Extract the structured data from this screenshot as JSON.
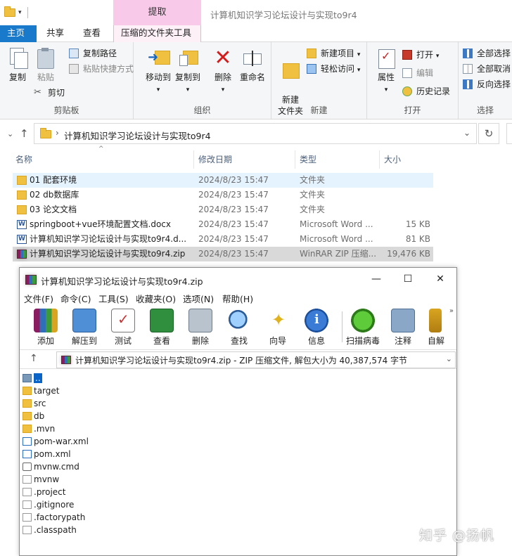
{
  "window": {
    "title": "计算机知识学习论坛设计与实现to9r4",
    "context_tab_header": "提取"
  },
  "tabs": [
    "主页",
    "共享",
    "查看",
    "压缩的文件夹工具"
  ],
  "ribbon": {
    "clipboard": {
      "label": "剪贴板",
      "copy": "复制",
      "paste": "粘贴",
      "copy_path": "复制路径",
      "paste_shortcut": "粘贴快捷方式",
      "cut": "剪切"
    },
    "organize": {
      "label": "组织",
      "move_to": "移动到",
      "copy_to": "复制到",
      "delete": "删除",
      "rename": "重命名"
    },
    "new": {
      "label": "新建",
      "new_folder": "新建\n文件夹",
      "new_item": "新建项目",
      "easy_access": "轻松访问"
    },
    "open": {
      "label": "打开",
      "properties": "属性",
      "open": "打开",
      "edit": "编辑",
      "history": "历史记录"
    },
    "select": {
      "label": "选择",
      "select_all": "全部选择",
      "select_none": "全部取消",
      "invert": "反向选择"
    }
  },
  "address": {
    "path": "计算机知识学习论坛设计与实现to9r4"
  },
  "columns": {
    "name": "名称",
    "date": "修改日期",
    "type": "类型",
    "size": "大小"
  },
  "files": [
    {
      "name": "01 配套环境",
      "date": "2024/8/23 15:47",
      "type": "文件夹",
      "size": "",
      "icon": "folder"
    },
    {
      "name": "02 db数据库",
      "date": "2024/8/23 15:47",
      "type": "文件夹",
      "size": "",
      "icon": "folder"
    },
    {
      "name": "03 论文文档",
      "date": "2024/8/23 15:47",
      "type": "文件夹",
      "size": "",
      "icon": "folder"
    },
    {
      "name": "springboot+vue环境配置文档.docx",
      "date": "2024/8/23 15:47",
      "type": "Microsoft Word ...",
      "size": "15 KB",
      "icon": "word"
    },
    {
      "name": "计算机知识学习论坛设计与实现to9r4.d...",
      "date": "2024/8/23 15:47",
      "type": "Microsoft Word ...",
      "size": "81 KB",
      "icon": "word"
    },
    {
      "name": "计算机知识学习论坛设计与实现to9r4.zip",
      "date": "2024/8/23 15:47",
      "type": "WinRAR ZIP 压缩...",
      "size": "19,476 KB",
      "icon": "rar"
    }
  ],
  "winrar": {
    "title": "计算机知识学习论坛设计与实现to9r4.zip",
    "menu": [
      "文件(F)",
      "命令(C)",
      "工具(S)",
      "收藏夹(O)",
      "选项(N)",
      "帮助(H)"
    ],
    "toolbar": [
      "添加",
      "解压到",
      "测试",
      "查看",
      "删除",
      "查找",
      "向导",
      "信息",
      "扫描病毒",
      "注释",
      "自解"
    ],
    "path": "计算机知识学习论坛设计与实现to9r4.zip - ZIP 压缩文件, 解包大小为 40,387,574 字节",
    "entries": [
      {
        "name": "..",
        "icon": "up"
      },
      {
        "name": "target",
        "icon": "folder"
      },
      {
        "name": "src",
        "icon": "folder"
      },
      {
        "name": "db",
        "icon": "folder"
      },
      {
        "name": ".mvn",
        "icon": "folder"
      },
      {
        "name": "pom-war.xml",
        "icon": "xml"
      },
      {
        "name": "pom.xml",
        "icon": "xml"
      },
      {
        "name": "mvnw.cmd",
        "icon": "cmd"
      },
      {
        "name": "mvnw",
        "icon": "file"
      },
      {
        "name": ".project",
        "icon": "file"
      },
      {
        "name": ".gitignore",
        "icon": "file"
      },
      {
        "name": ".factorypath",
        "icon": "file"
      },
      {
        "name": ".classpath",
        "icon": "file"
      }
    ]
  },
  "watermark": "知乎 @扬帆"
}
